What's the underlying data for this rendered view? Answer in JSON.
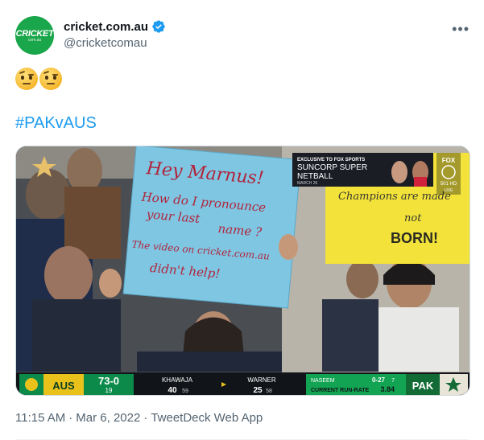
{
  "author": {
    "display_name": "cricket.com.au",
    "handle": "@cricketcomau",
    "avatar_text": "CRICKET",
    "avatar_sub": "com.au",
    "verified": true
  },
  "tweet": {
    "emoji_text": "🤨🤨",
    "hashtag": "#PAKvAUS",
    "time": "11:15 AM",
    "separator": "·",
    "date": "Mar 6, 2022",
    "source": "TweetDeck Web App"
  },
  "icons": {
    "more": "more-horizontal-icon",
    "verified": "verified-badge-icon"
  },
  "media": {
    "main_sign": {
      "line1": "Hey Marnus!",
      "line2": "How do I pronounce",
      "line3": "your last",
      "line4": "name ?",
      "line5": "The video on cricket.com.au",
      "line6": "didn't help!"
    },
    "yellow_sign": {
      "line1": "Champions are made",
      "line2": "not",
      "line3": "BORN!"
    },
    "ad": {
      "line1": "EXCLUSIVE TO FOX SPORTS",
      "line2": "SUNCORP SUPER",
      "line3": "NETBALL",
      "line4": "MARCH 26"
    },
    "broadcaster": {
      "line1": "FOX",
      "line2": "501 HD",
      "line3": "LIVE"
    },
    "scoreboard": {
      "batting_team": "AUS",
      "score": "73-0",
      "overs": "19",
      "batter1_name": "KHAWAJA",
      "batter1_runs": "40",
      "batter1_balls": "59",
      "batter2_name": "WARNER",
      "batter2_runs": "25",
      "batter2_balls": "58",
      "bowler_name": "NASEEM",
      "bowler_figures": "0-27",
      "bowler_overs": "7",
      "run_rate_label": "CURRENT RUN-RATE",
      "run_rate": "3.84",
      "bowling_team": "PAK"
    },
    "colors": {
      "sign_blue": "#7fc6e3",
      "sign_ink": "#b0243a",
      "yellow_sign": "#f2e23a",
      "score_green": "#0c8a4a",
      "aus_gold": "#e8c21a",
      "pak_green": "#126b35"
    }
  }
}
